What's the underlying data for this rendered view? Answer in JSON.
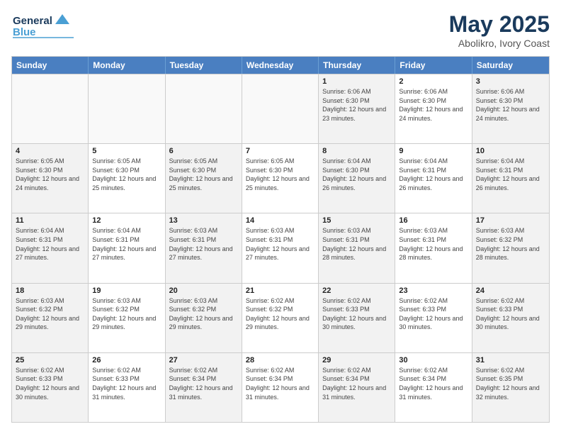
{
  "header": {
    "logo_line1": "General",
    "logo_line2": "Blue",
    "title": "May 2025",
    "subtitle": "Abolikro, Ivory Coast"
  },
  "days_of_week": [
    "Sunday",
    "Monday",
    "Tuesday",
    "Wednesday",
    "Thursday",
    "Friday",
    "Saturday"
  ],
  "rows": [
    [
      {
        "day": "",
        "sunrise": "",
        "sunset": "",
        "daylight": "",
        "empty": true
      },
      {
        "day": "",
        "sunrise": "",
        "sunset": "",
        "daylight": "",
        "empty": true
      },
      {
        "day": "",
        "sunrise": "",
        "sunset": "",
        "daylight": "",
        "empty": true
      },
      {
        "day": "",
        "sunrise": "",
        "sunset": "",
        "daylight": "",
        "empty": true
      },
      {
        "day": "1",
        "sunrise": "Sunrise: 6:06 AM",
        "sunset": "Sunset: 6:30 PM",
        "daylight": "Daylight: 12 hours and 23 minutes.",
        "empty": false
      },
      {
        "day": "2",
        "sunrise": "Sunrise: 6:06 AM",
        "sunset": "Sunset: 6:30 PM",
        "daylight": "Daylight: 12 hours and 24 minutes.",
        "empty": false
      },
      {
        "day": "3",
        "sunrise": "Sunrise: 6:06 AM",
        "sunset": "Sunset: 6:30 PM",
        "daylight": "Daylight: 12 hours and 24 minutes.",
        "empty": false
      }
    ],
    [
      {
        "day": "4",
        "sunrise": "Sunrise: 6:05 AM",
        "sunset": "Sunset: 6:30 PM",
        "daylight": "Daylight: 12 hours and 24 minutes.",
        "empty": false
      },
      {
        "day": "5",
        "sunrise": "Sunrise: 6:05 AM",
        "sunset": "Sunset: 6:30 PM",
        "daylight": "Daylight: 12 hours and 25 minutes.",
        "empty": false
      },
      {
        "day": "6",
        "sunrise": "Sunrise: 6:05 AM",
        "sunset": "Sunset: 6:30 PM",
        "daylight": "Daylight: 12 hours and 25 minutes.",
        "empty": false
      },
      {
        "day": "7",
        "sunrise": "Sunrise: 6:05 AM",
        "sunset": "Sunset: 6:30 PM",
        "daylight": "Daylight: 12 hours and 25 minutes.",
        "empty": false
      },
      {
        "day": "8",
        "sunrise": "Sunrise: 6:04 AM",
        "sunset": "Sunset: 6:30 PM",
        "daylight": "Daylight: 12 hours and 26 minutes.",
        "empty": false
      },
      {
        "day": "9",
        "sunrise": "Sunrise: 6:04 AM",
        "sunset": "Sunset: 6:31 PM",
        "daylight": "Daylight: 12 hours and 26 minutes.",
        "empty": false
      },
      {
        "day": "10",
        "sunrise": "Sunrise: 6:04 AM",
        "sunset": "Sunset: 6:31 PM",
        "daylight": "Daylight: 12 hours and 26 minutes.",
        "empty": false
      }
    ],
    [
      {
        "day": "11",
        "sunrise": "Sunrise: 6:04 AM",
        "sunset": "Sunset: 6:31 PM",
        "daylight": "Daylight: 12 hours and 27 minutes.",
        "empty": false
      },
      {
        "day": "12",
        "sunrise": "Sunrise: 6:04 AM",
        "sunset": "Sunset: 6:31 PM",
        "daylight": "Daylight: 12 hours and 27 minutes.",
        "empty": false
      },
      {
        "day": "13",
        "sunrise": "Sunrise: 6:03 AM",
        "sunset": "Sunset: 6:31 PM",
        "daylight": "Daylight: 12 hours and 27 minutes.",
        "empty": false
      },
      {
        "day": "14",
        "sunrise": "Sunrise: 6:03 AM",
        "sunset": "Sunset: 6:31 PM",
        "daylight": "Daylight: 12 hours and 27 minutes.",
        "empty": false
      },
      {
        "day": "15",
        "sunrise": "Sunrise: 6:03 AM",
        "sunset": "Sunset: 6:31 PM",
        "daylight": "Daylight: 12 hours and 28 minutes.",
        "empty": false
      },
      {
        "day": "16",
        "sunrise": "Sunrise: 6:03 AM",
        "sunset": "Sunset: 6:31 PM",
        "daylight": "Daylight: 12 hours and 28 minutes.",
        "empty": false
      },
      {
        "day": "17",
        "sunrise": "Sunrise: 6:03 AM",
        "sunset": "Sunset: 6:32 PM",
        "daylight": "Daylight: 12 hours and 28 minutes.",
        "empty": false
      }
    ],
    [
      {
        "day": "18",
        "sunrise": "Sunrise: 6:03 AM",
        "sunset": "Sunset: 6:32 PM",
        "daylight": "Daylight: 12 hours and 29 minutes.",
        "empty": false
      },
      {
        "day": "19",
        "sunrise": "Sunrise: 6:03 AM",
        "sunset": "Sunset: 6:32 PM",
        "daylight": "Daylight: 12 hours and 29 minutes.",
        "empty": false
      },
      {
        "day": "20",
        "sunrise": "Sunrise: 6:03 AM",
        "sunset": "Sunset: 6:32 PM",
        "daylight": "Daylight: 12 hours and 29 minutes.",
        "empty": false
      },
      {
        "day": "21",
        "sunrise": "Sunrise: 6:02 AM",
        "sunset": "Sunset: 6:32 PM",
        "daylight": "Daylight: 12 hours and 29 minutes.",
        "empty": false
      },
      {
        "day": "22",
        "sunrise": "Sunrise: 6:02 AM",
        "sunset": "Sunset: 6:33 PM",
        "daylight": "Daylight: 12 hours and 30 minutes.",
        "empty": false
      },
      {
        "day": "23",
        "sunrise": "Sunrise: 6:02 AM",
        "sunset": "Sunset: 6:33 PM",
        "daylight": "Daylight: 12 hours and 30 minutes.",
        "empty": false
      },
      {
        "day": "24",
        "sunrise": "Sunrise: 6:02 AM",
        "sunset": "Sunset: 6:33 PM",
        "daylight": "Daylight: 12 hours and 30 minutes.",
        "empty": false
      }
    ],
    [
      {
        "day": "25",
        "sunrise": "Sunrise: 6:02 AM",
        "sunset": "Sunset: 6:33 PM",
        "daylight": "Daylight: 12 hours and 30 minutes.",
        "empty": false
      },
      {
        "day": "26",
        "sunrise": "Sunrise: 6:02 AM",
        "sunset": "Sunset: 6:33 PM",
        "daylight": "Daylight: 12 hours and 31 minutes.",
        "empty": false
      },
      {
        "day": "27",
        "sunrise": "Sunrise: 6:02 AM",
        "sunset": "Sunset: 6:34 PM",
        "daylight": "Daylight: 12 hours and 31 minutes.",
        "empty": false
      },
      {
        "day": "28",
        "sunrise": "Sunrise: 6:02 AM",
        "sunset": "Sunset: 6:34 PM",
        "daylight": "Daylight: 12 hours and 31 minutes.",
        "empty": false
      },
      {
        "day": "29",
        "sunrise": "Sunrise: 6:02 AM",
        "sunset": "Sunset: 6:34 PM",
        "daylight": "Daylight: 12 hours and 31 minutes.",
        "empty": false
      },
      {
        "day": "30",
        "sunrise": "Sunrise: 6:02 AM",
        "sunset": "Sunset: 6:34 PM",
        "daylight": "Daylight: 12 hours and 31 minutes.",
        "empty": false
      },
      {
        "day": "31",
        "sunrise": "Sunrise: 6:02 AM",
        "sunset": "Sunset: 6:35 PM",
        "daylight": "Daylight: 12 hours and 32 minutes.",
        "empty": false
      }
    ]
  ]
}
